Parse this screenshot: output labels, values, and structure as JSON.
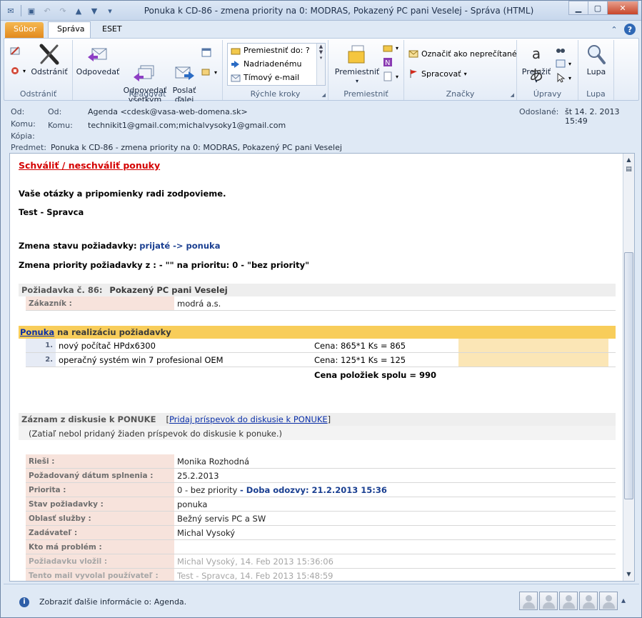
{
  "window": {
    "title": "Ponuka k CD-86 - zmena priority na 0: MODRAS, Pokazený PC pani  Veselej  -  Správa (HTML)"
  },
  "tabs": {
    "file": "Súbor",
    "message": "Správa",
    "eset": "ESET"
  },
  "ribbon": {
    "delete_group": "Odstrániť",
    "delete": "Odstrániť",
    "respond_group": "Reagovať",
    "reply": "Odpovedať",
    "reply_all": "Odpovedať\nvšetkým",
    "forward": "Poslať\nďalej",
    "quick_steps_group": "Rýchle kroky",
    "quick_steps": [
      "Premiestniť do: ?",
      "Nadriadenému",
      "Tímový e-mail"
    ],
    "move_group": "Premiestniť",
    "move": "Premiestniť",
    "tags_group": "Značky",
    "mark_unread": "Označiť ako neprečítané",
    "followup": "Spracovať",
    "editing_group": "Úpravy",
    "translate": "Preložiť",
    "zoom_group": "Lupa",
    "zoom": "Lupa"
  },
  "header": {
    "from_label": "Od:",
    "from_label2": "Od:",
    "from": "Agenda <cdesk@vasa-web-domena.sk>",
    "to_label": "Komu:",
    "to_label2": "Komu:",
    "to": "technikit1@gmail.com;michalvysoky1@gmail.com",
    "cc_label": "Kópia:",
    "subject_label": "Predmet:",
    "subject": "Ponuka k CD-86 - zmena priority na 0: MODRAS, Pokazený PC pani  Veselej",
    "sent_label": "Odoslané:",
    "sent": "št 14. 2. 2013 15:49"
  },
  "message": {
    "approve_link": "Schváliť / neschváliť ponuky",
    "questions": "Vaše otázky a pripomienky radi zodpovieme.",
    "signature": "Test - Spravca",
    "state_change_label": "Zmena stavu požiadavky:",
    "state_change_value": "prijaté -> ponuka",
    "priority_change": "Zmena priority požiadavky z : - \"\" na prioritu: 0 - \"bez priority\"",
    "request_label": "Požiadavka č. 86:",
    "request_title": "Pokazený PC pani Veselej",
    "customer_label": "Zákazník :",
    "customer": "modrá a.s.",
    "offer_link": "Ponuka",
    "offer_suffix": "na realizáciu požiadavky",
    "items": [
      {
        "num": "1.",
        "name": "nový počítač HPdx6300",
        "price": "Cena: 865*1 Ks = 865"
      },
      {
        "num": "2.",
        "name": "operačný systém win 7 profesional OEM",
        "price": "Cena: 125*1 Ks = 125"
      }
    ],
    "total": "Cena položiek spolu = 990",
    "discussion_label": "Záznam z diskusie k PONUKE",
    "discussion_open": "[",
    "discussion_link": "Pridaj príspevok do diskusie k PONUKE",
    "discussion_close": "]",
    "discussion_empty": "(Zatiaľ nebol pridaný žiaden príspevok do diskusie k ponuke.)",
    "details": {
      "solver_label": "Rieši :",
      "solver": "Monika Rozhodná",
      "date_label": "Požadovaný dátum splnenia :",
      "date": "25.2.2013",
      "priority_label": "Priorita :",
      "priority": "0 - bez priority",
      "response_time": "- Doba odozvy: 21.2.2013 15:36",
      "state_label": "Stav požiadavky :",
      "state": "ponuka",
      "area_label": "Oblasť služby :",
      "area": "Bežný servis PC a SW",
      "submitter_label": "Zadávateľ :",
      "submitter": "Michal Vysoký",
      "problem_label": "Kto má problém :",
      "problem": "",
      "inserted_label": "Požiadavku vložil :",
      "inserted": "Michal Vysoký, 14. Feb 2013 15:36:06",
      "triggered_label": "Tento mail vyvolal používateľ :",
      "triggered": "Test - Spravca, 14. Feb 2013 15:48:59"
    }
  },
  "status": {
    "info": "Zobraziť ďalšie informácie o: Agenda."
  }
}
